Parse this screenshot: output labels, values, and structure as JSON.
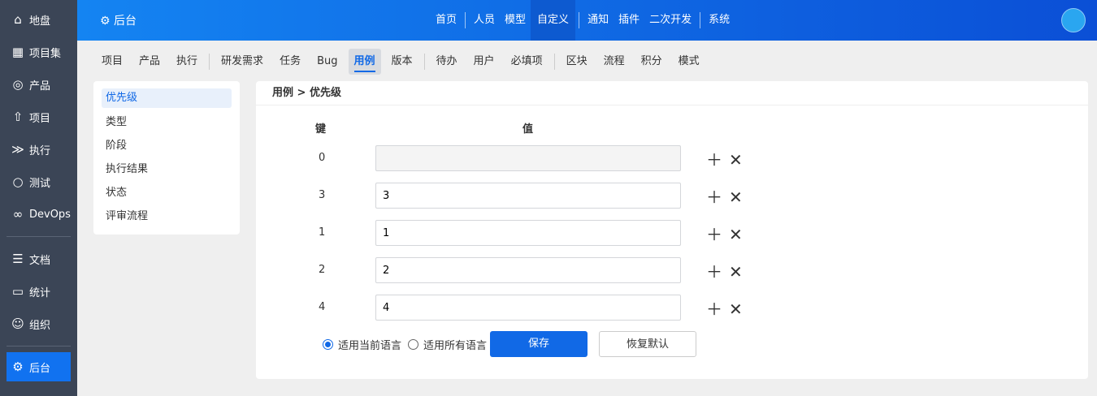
{
  "sidebar": {
    "items": [
      {
        "label": "地盘",
        "icon": "home-icon"
      },
      {
        "label": "项目集",
        "icon": "grid-icon"
      },
      {
        "label": "产品",
        "icon": "lightbulb-icon"
      },
      {
        "label": "项目",
        "icon": "rocket-icon"
      },
      {
        "label": "执行",
        "icon": "run-icon"
      },
      {
        "label": "测试",
        "icon": "search-icon"
      },
      {
        "label": "DevOps",
        "icon": "infinity-icon"
      },
      {
        "label": "文档",
        "icon": "doc-icon"
      },
      {
        "label": "统计",
        "icon": "chart-icon"
      },
      {
        "label": "组织",
        "icon": "users-icon"
      },
      {
        "label": "后台",
        "icon": "gear-icon"
      }
    ]
  },
  "header": {
    "title": "后台",
    "menu": [
      "首页",
      "人员",
      "模型",
      "自定义",
      "通知",
      "插件",
      "二次开发",
      "系统"
    ]
  },
  "subnav": [
    "项目",
    "产品",
    "执行",
    "研发需求",
    "任务",
    "Bug",
    "用例",
    "版本",
    "待办",
    "用户",
    "必填项",
    "区块",
    "流程",
    "积分",
    "模式"
  ],
  "leftnav": [
    "优先级",
    "类型",
    "阶段",
    "执行结果",
    "状态",
    "评审流程"
  ],
  "breadcrumb": {
    "parent": "用例",
    "current": "优先级"
  },
  "table": {
    "key_header": "键",
    "value_header": "值",
    "rows": [
      {
        "key": "0",
        "value": ""
      },
      {
        "key": "3",
        "value": "3"
      },
      {
        "key": "1",
        "value": "1"
      },
      {
        "key": "2",
        "value": "2"
      },
      {
        "key": "4",
        "value": "4"
      }
    ]
  },
  "footer": {
    "radio_current": "适用当前语言",
    "radio_all": "适用所有语言",
    "save": "保存",
    "reset": "恢复默认"
  }
}
